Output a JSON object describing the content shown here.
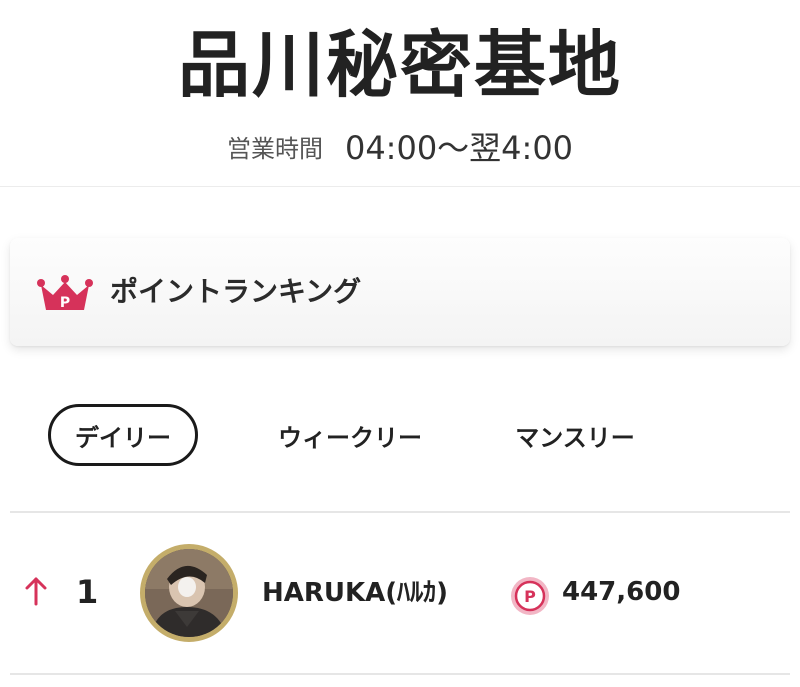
{
  "header": {
    "title": "品川秘密基地",
    "hours_label": "営業時間",
    "hours_value": "04:00〜翌4:00"
  },
  "ranking": {
    "title": "ポイントランキング",
    "icon": "crown-icon",
    "accent_color": "#d6325a"
  },
  "tabs": [
    {
      "label": "デイリー",
      "selected": true
    },
    {
      "label": "ウィークリー",
      "selected": false
    },
    {
      "label": "マンスリー",
      "selected": false
    }
  ],
  "rows": [
    {
      "trend": "up",
      "trend_icon": "arrow-up-icon",
      "rank": "1",
      "name": "HARUKA(ﾊﾙｶ)",
      "point_icon": "point-icon",
      "points": "447,600"
    }
  ]
}
